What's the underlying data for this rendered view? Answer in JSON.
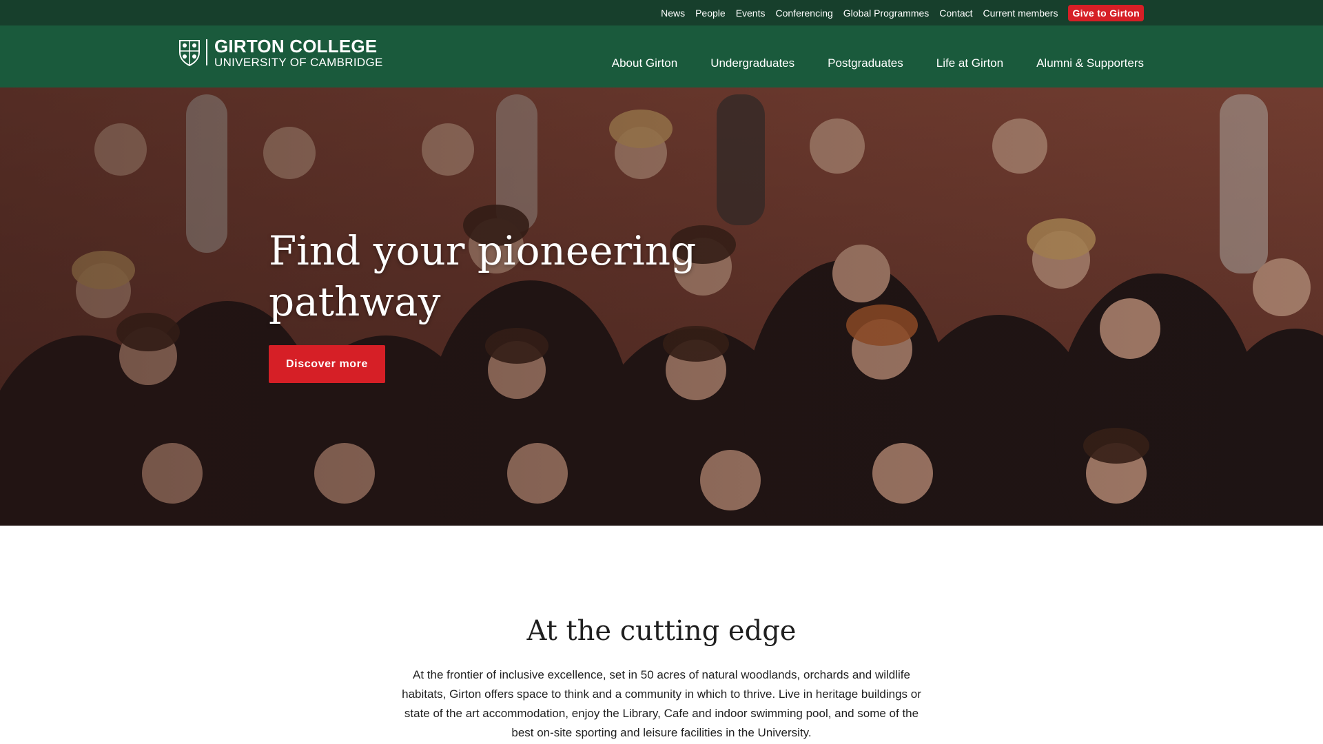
{
  "utility_nav": {
    "links": [
      "News",
      "People",
      "Events",
      "Conferencing",
      "Global Programmes",
      "Contact",
      "Current members"
    ],
    "give_label": "Give to Girton",
    "give_color": "#d61f26"
  },
  "header": {
    "logo_name": "GIRTON COLLEGE",
    "logo_sub": "UNIVERSITY OF CAMBRIDGE",
    "logo_icon": "college-crest-icon",
    "nav": [
      "About Girton",
      "Undergraduates",
      "Postgraduates",
      "Life at Girton",
      "Alumni & Supporters"
    ]
  },
  "hero": {
    "title_line1": "Find your pioneering",
    "title_line2": "pathway",
    "button_label": "Discover more",
    "image": "group-of-students-in-gowns-photo"
  },
  "intro": {
    "heading": "At the cutting edge",
    "body": "At the frontier of inclusive excellence, set in 50 acres of natural woodlands, orchards and wildlife habitats, Girton offers space to think and a community in which to thrive. Live in heritage buildings or state of the art accommodation, enjoy the Library, Cafe and indoor swimming pool, and some of the best on-site sporting and leisure facilities in the University."
  },
  "colors": {
    "utility_bar": "#173f2c",
    "header": "#1a5a3c",
    "accent_red": "#d61f26"
  }
}
